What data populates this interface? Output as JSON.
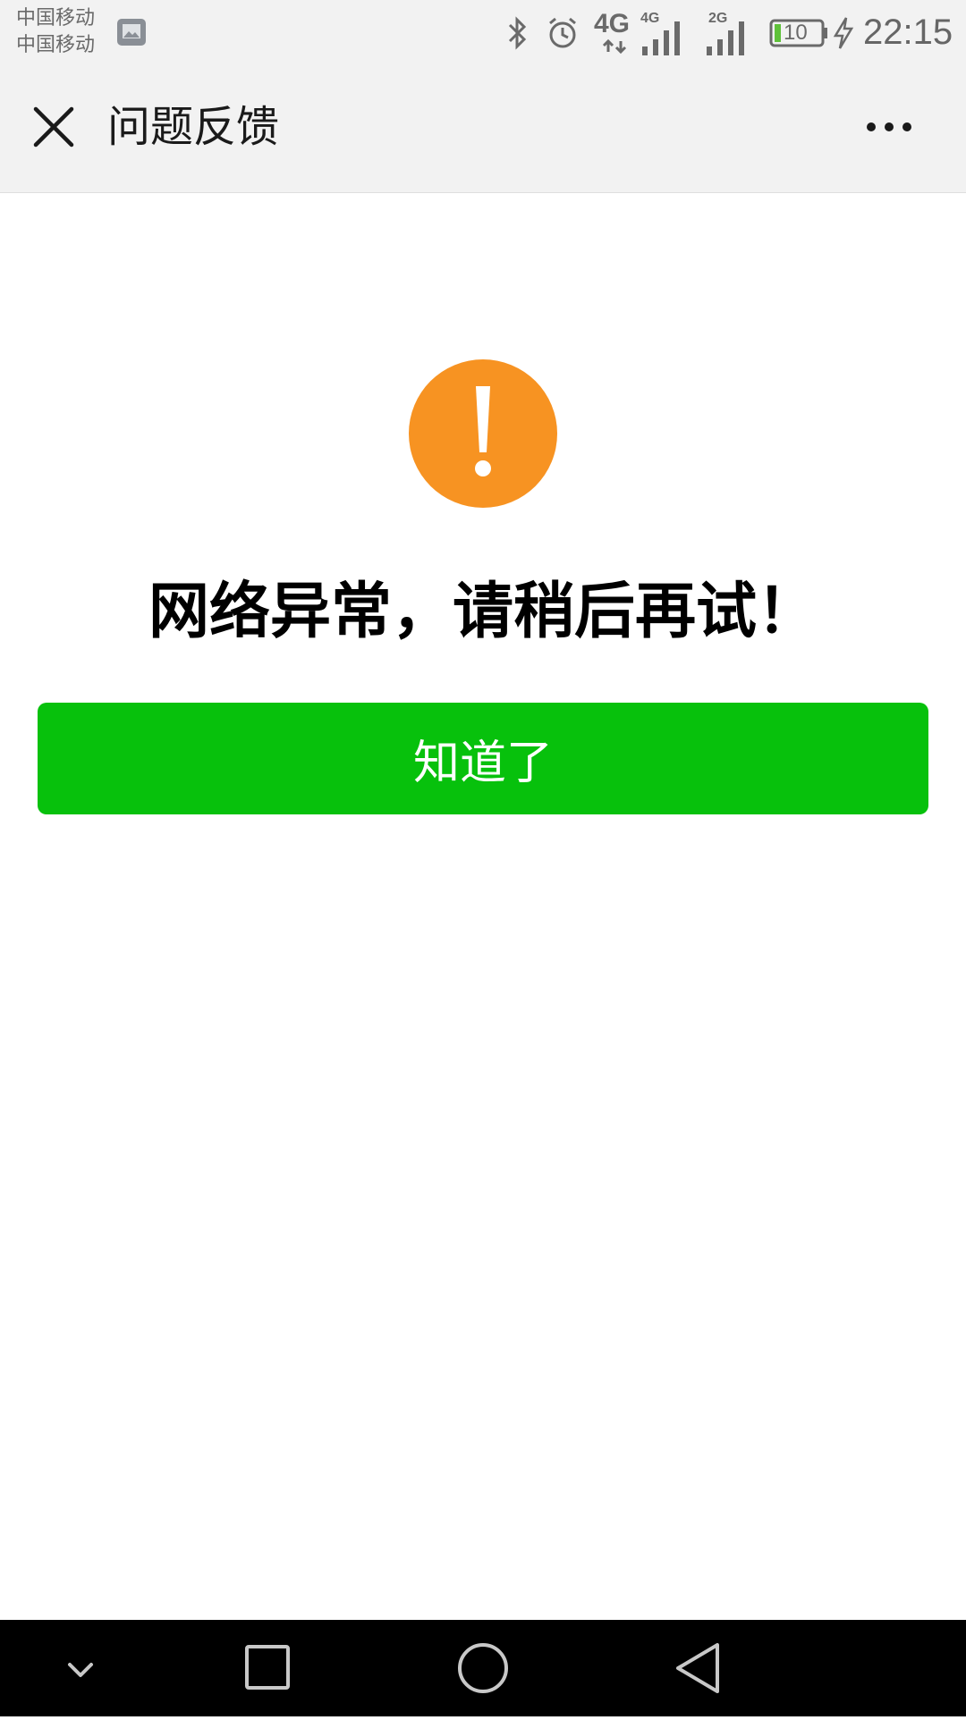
{
  "status_bar": {
    "carrier_1": "中国移动",
    "carrier_2": "中国移动",
    "network_1": "4G",
    "network_2": "4G",
    "network_3": "2G",
    "battery_level": "10",
    "time": "22:15"
  },
  "title_bar": {
    "title": "问题反馈"
  },
  "main": {
    "message": "网络异常，请稍后再试！",
    "confirm_label": "知道了"
  },
  "colors": {
    "accent_green": "#07c10c",
    "warning_orange": "#f79322",
    "bar_background": "#f2f2f2"
  },
  "icons": {
    "close": "close-icon",
    "more": "more-icon",
    "warning": "warning-icon"
  }
}
